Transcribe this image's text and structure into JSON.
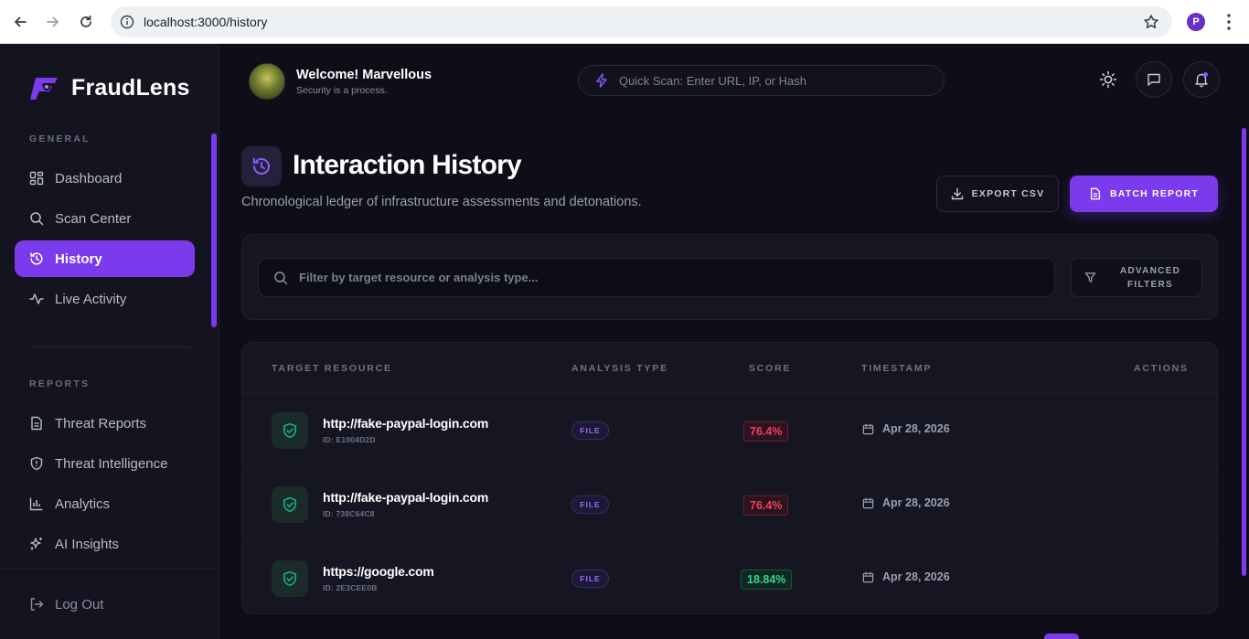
{
  "browser": {
    "url": "localhost:3000/history",
    "profile_initial": "P"
  },
  "brand": {
    "name": "FraudLens",
    "accent": "#7c3aed"
  },
  "sidebar": {
    "general_label": "GENERAL",
    "general_items": [
      {
        "label": "Dashboard",
        "icon": "grid-icon"
      },
      {
        "label": "Scan Center",
        "icon": "search-icon"
      },
      {
        "label": "History",
        "icon": "history-icon",
        "active": true
      },
      {
        "label": "Live Activity",
        "icon": "activity-icon"
      }
    ],
    "reports_label": "REPORTS",
    "reports_items": [
      {
        "label": "Threat Reports",
        "icon": "document-icon"
      },
      {
        "label": "Threat Intelligence",
        "icon": "shield-icon"
      },
      {
        "label": "Analytics",
        "icon": "bar-chart-icon"
      },
      {
        "label": "AI Insights",
        "icon": "sparkles-icon"
      }
    ],
    "logout_label": "Log Out"
  },
  "header": {
    "welcome": "Welcome! Marvellous",
    "tagline": "Security is a process.",
    "quickscan_placeholder": "Quick Scan: Enter URL, IP, or Hash"
  },
  "page": {
    "title": "Interaction History",
    "subtitle": "Chronological ledger of infrastructure assessments and detonations.",
    "export_label": "EXPORT CSV",
    "batch_label": "BATCH REPORT",
    "filter_placeholder": "Filter by target resource or analysis type...",
    "advanced_filters_label": "ADVANCED FILTERS"
  },
  "table": {
    "columns": [
      "TARGET RESOURCE",
      "ANALYSIS TYPE",
      "SCORE",
      "TIMESTAMP",
      "ACTIONS"
    ],
    "rows": [
      {
        "target": "http://fake-paypal-login.com",
        "id": "ID: E1904D2D",
        "type": "FILE",
        "score": "76.4%",
        "level": "high",
        "timestamp": "Apr 28, 2026"
      },
      {
        "target": "http://fake-paypal-login.com",
        "id": "ID: 738C64C8",
        "type": "FILE",
        "score": "76.4%",
        "level": "high",
        "timestamp": "Apr 28, 2026"
      },
      {
        "target": "https://google.com",
        "id": "ID: 2E3CEE0B",
        "type": "FILE",
        "score": "18.84%",
        "level": "low",
        "timestamp": "Apr 28, 2026"
      }
    ]
  },
  "colors": {
    "high_risk": "#f43f5e",
    "low_risk": "#34d399",
    "safe_icon": "#10b981"
  }
}
